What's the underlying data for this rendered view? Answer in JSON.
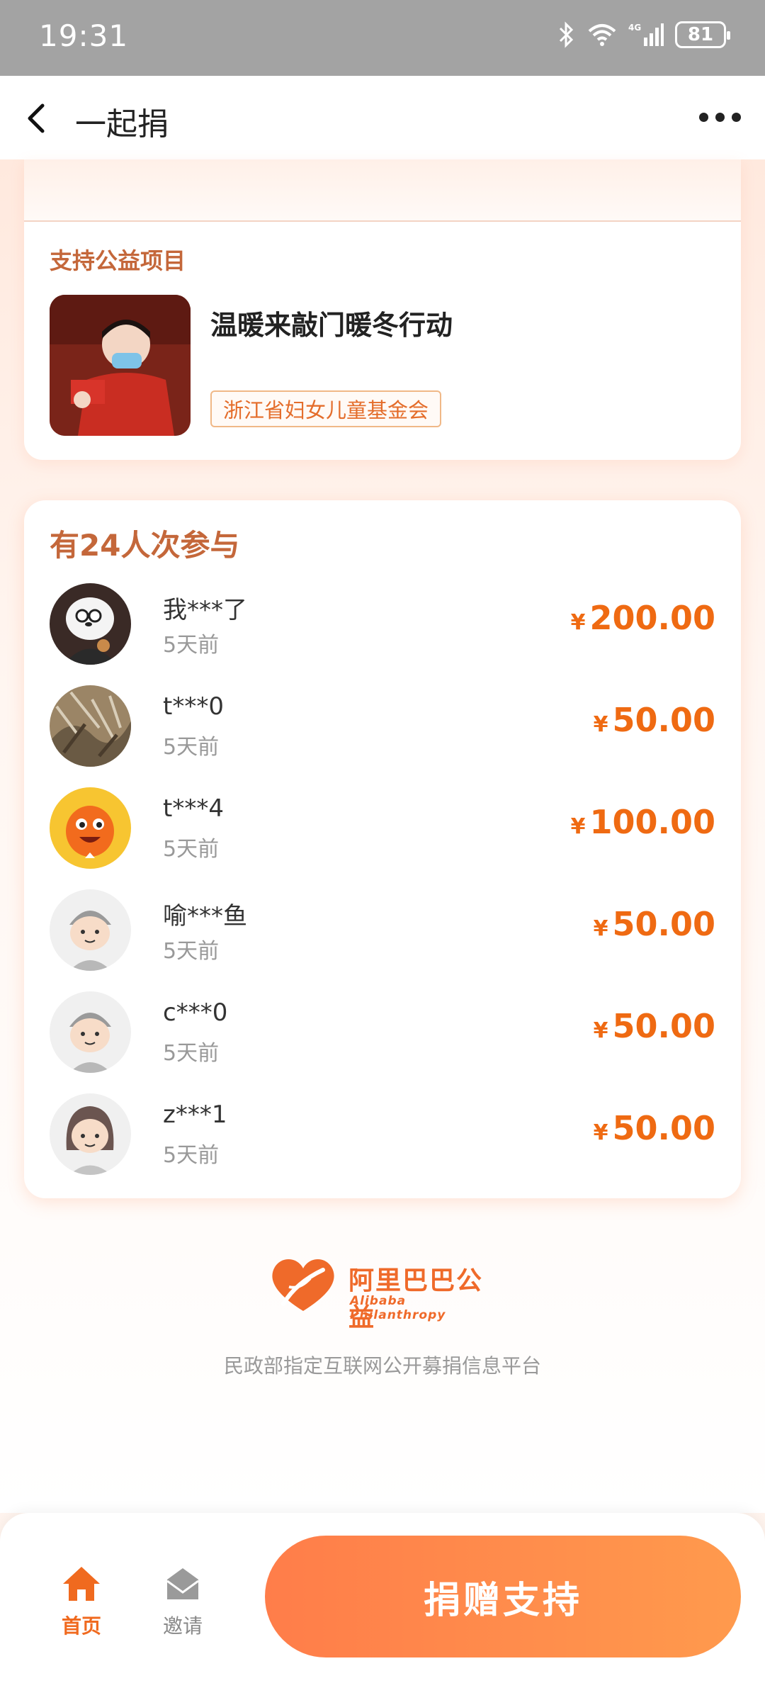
{
  "status_bar": {
    "time": "19:31",
    "battery": "81",
    "network": "4G"
  },
  "nav": {
    "title": "一起捐"
  },
  "project": {
    "section_label": "支持公益项目",
    "title": "温暖来敲门暖冬行动",
    "organization": "浙江省妇女儿童基金会"
  },
  "donors": {
    "heading": "有24人次参与",
    "currency": "¥",
    "items": [
      {
        "name": "我***了",
        "time": "5天前",
        "amount": "200.00",
        "avatar": "panda-bear-avatar"
      },
      {
        "name": "t***0",
        "time": "5天前",
        "amount": "50.00",
        "avatar": "grass-photo-avatar"
      },
      {
        "name": "t***4",
        "time": "5天前",
        "amount": "100.00",
        "avatar": "orange-mascot-avatar"
      },
      {
        "name": "喻***鱼",
        "time": "5天前",
        "amount": "50.00",
        "avatar": "boy-cartoon-avatar"
      },
      {
        "name": "c***0",
        "time": "5天前",
        "amount": "50.00",
        "avatar": "boy-cartoon-avatar"
      },
      {
        "name": "z***1",
        "time": "5天前",
        "amount": "50.00",
        "avatar": "girl-cartoon-avatar"
      }
    ]
  },
  "footer": {
    "logo_cn": "阿里巴巴公益",
    "logo_en": "Alibaba Philanthropy",
    "platform_text": "民政部指定互联网公开募捐信息平台"
  },
  "bottom_bar": {
    "home_label": "首页",
    "invite_label": "邀请",
    "donate_label": "捐赠支持"
  },
  "colors": {
    "accent": "#ef6a12",
    "heading": "#c4673a",
    "button": "#ff8a4b"
  }
}
